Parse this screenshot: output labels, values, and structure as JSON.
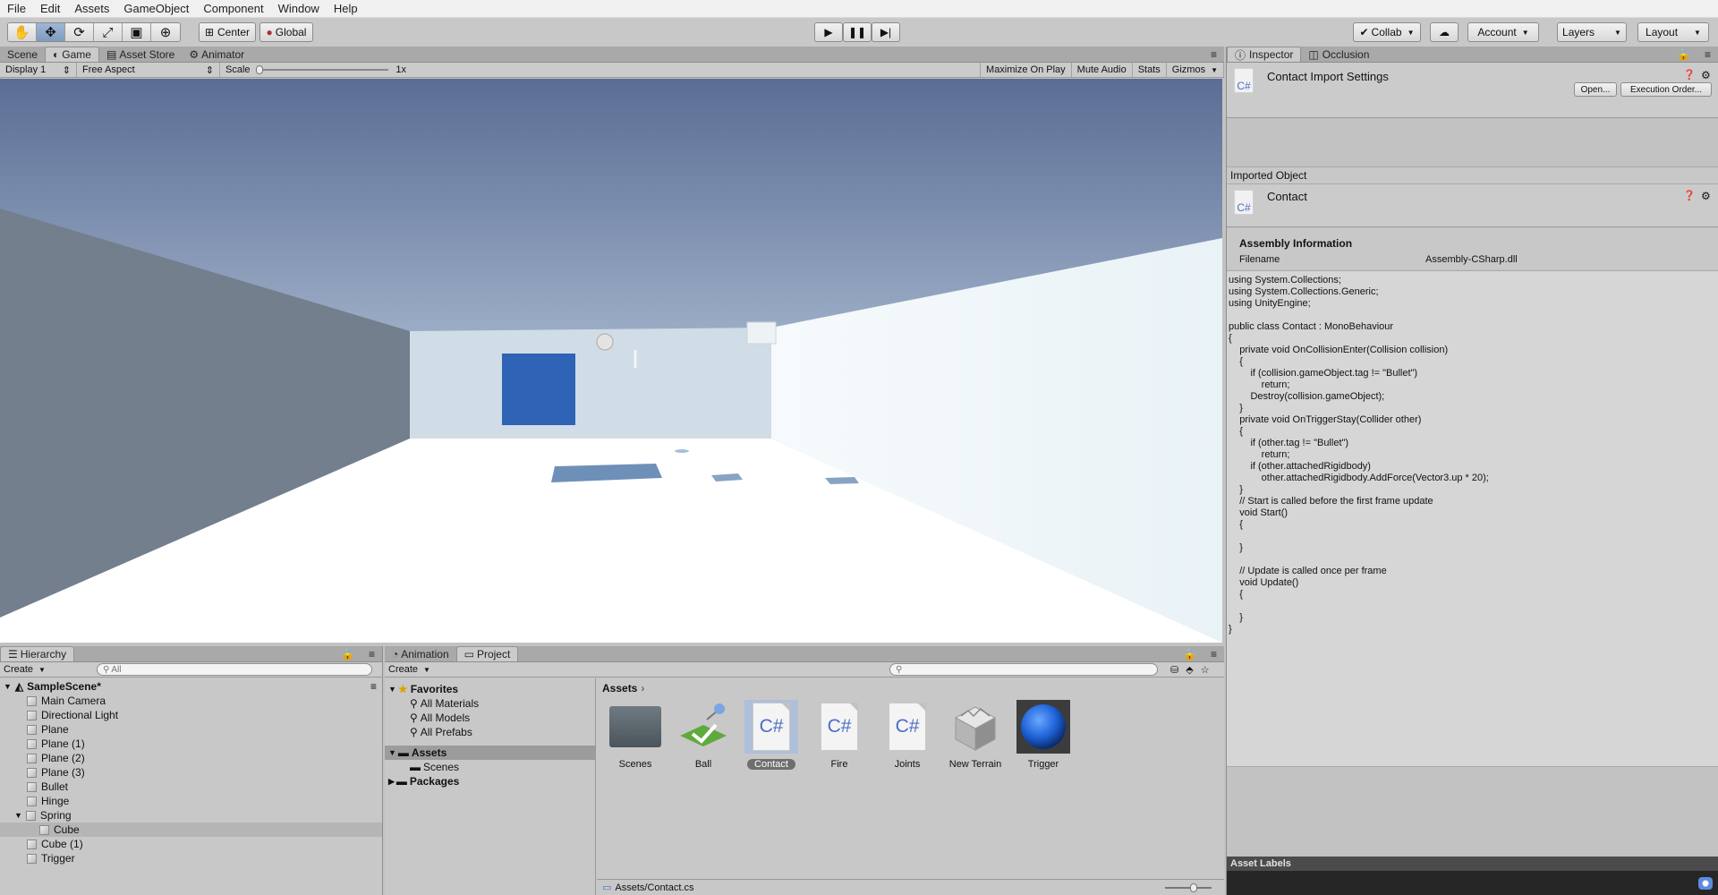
{
  "menu": [
    "File",
    "Edit",
    "Assets",
    "GameObject",
    "Component",
    "Window",
    "Help"
  ],
  "toolbar": {
    "tools": [
      "hand-tool-icon",
      "move-tool-icon",
      "rotate-tool-icon",
      "scale-tool-icon",
      "rect-tool-icon",
      "transform-tool-icon"
    ],
    "pivot": "Center",
    "space": "Global",
    "collab": "Collab",
    "account": "Account",
    "layers": "Layers",
    "layout": "Layout"
  },
  "game": {
    "tabs": [
      "Scene",
      "Game",
      "Asset Store",
      "Animator"
    ],
    "display": "Display 1",
    "aspect": "Free Aspect",
    "scale_label": "Scale",
    "scale_value": "1x",
    "maximize": "Maximize On Play",
    "mute": "Mute Audio",
    "stats": "Stats",
    "gizmos": "Gizmos"
  },
  "inspector": {
    "tabs": [
      "Inspector",
      "Occlusion"
    ],
    "title": "Contact Import Settings",
    "cs_label": "C#",
    "open_btn": "Open...",
    "exec_btn": "Execution Order...",
    "imported_object": "Imported Object",
    "object_name": "Contact",
    "assembly_header": "Assembly Information",
    "filename_label": "Filename",
    "filename_value": "Assembly-CSharp.dll",
    "code": "using System.Collections;\nusing System.Collections.Generic;\nusing UnityEngine;\n\npublic class Contact : MonoBehaviour\n{\n    private void OnCollisionEnter(Collision collision)\n    {\n        if (collision.gameObject.tag != \"Bullet\")\n            return;\n        Destroy(collision.gameObject);\n    }\n    private void OnTriggerStay(Collider other)\n    {\n        if (other.tag != \"Bullet\")\n            return;\n        if (other.attachedRigidbody)\n            other.attachedRigidbody.AddForce(Vector3.up * 20);\n    }\n    // Start is called before the first frame update\n    void Start()\n    {\n\n    }\n\n    // Update is called once per frame\n    void Update()\n    {\n\n    }\n}",
    "asset_labels": "Asset Labels"
  },
  "hierarchy": {
    "tab": "Hierarchy",
    "create": "Create",
    "search_placeholder": "All",
    "scene": "SampleScene*",
    "items": [
      {
        "label": "Main Camera",
        "indent": 0
      },
      {
        "label": "Directional Light",
        "indent": 0
      },
      {
        "label": "Plane",
        "indent": 0
      },
      {
        "label": "Plane (1)",
        "indent": 0
      },
      {
        "label": "Plane (2)",
        "indent": 0
      },
      {
        "label": "Plane (3)",
        "indent": 0
      },
      {
        "label": "Bullet",
        "indent": 0
      },
      {
        "label": "Hinge",
        "indent": 0
      },
      {
        "label": "Spring",
        "indent": 0
      },
      {
        "label": "Cube",
        "indent": 1
      },
      {
        "label": "Cube (1)",
        "indent": 0
      },
      {
        "label": "Trigger",
        "indent": 0
      }
    ]
  },
  "project": {
    "tabs": [
      "Animation",
      "Project"
    ],
    "create": "Create",
    "favorites": "Favorites",
    "favorite_items": [
      "All Materials",
      "All Models",
      "All Prefabs"
    ],
    "assets_folder": "Assets",
    "scenes_folder": "Scenes",
    "packages_folder": "Packages",
    "breadcrumb": "Assets",
    "assets": [
      "Scenes",
      "Ball",
      "Contact",
      "Fire",
      "Joints",
      "New Terrain",
      "Trigger"
    ],
    "cs_glyph": "C#",
    "path": "Assets/Contact.cs"
  }
}
